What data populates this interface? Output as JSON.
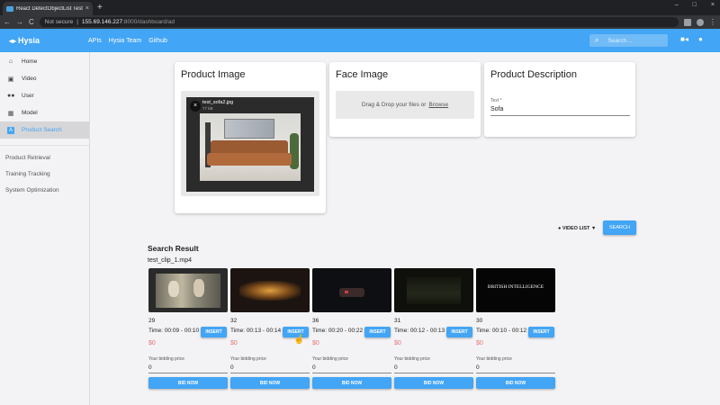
{
  "browser": {
    "tab_title": "React DetectObjectList Test",
    "tab_close": "×",
    "new_tab": "+",
    "security": "Not secure",
    "url_host": "155.69.146.227",
    "url_path": ":8000/dashboard/ad",
    "nav": {
      "back": "←",
      "forward": "→",
      "reload": "C"
    },
    "window": {
      "minimize": "–",
      "maximize": "□",
      "close": "×"
    }
  },
  "header": {
    "logo": "Hysia",
    "links": [
      "APIs",
      "Hysia Team",
      "Github"
    ],
    "search_placeholder": "Search…",
    "search_icon": "search-icon",
    "camera_icon": "videocam-icon",
    "account_icon": "account-icon",
    "colors": {
      "primary": "#42a5f5",
      "price": "#e57373"
    }
  },
  "sidebar": {
    "items": [
      {
        "label": "Home",
        "icon": "home-icon"
      },
      {
        "label": "Video",
        "icon": "video-library-icon"
      },
      {
        "label": "User",
        "icon": "people-icon"
      },
      {
        "label": "Model",
        "icon": "grid-icon"
      },
      {
        "label": "Product Search",
        "icon": "product-search-icon"
      }
    ],
    "links": [
      "Product Retrieval",
      "Training Tracking",
      "System Optimization"
    ]
  },
  "product_image": {
    "title": "Product Image",
    "file_name": "test_sofa2.jpg",
    "file_size": "77 kB",
    "close": "×"
  },
  "face_image": {
    "title": "Face Image",
    "drop_text": "Drag & Drop your files or",
    "browse": "Browse"
  },
  "product_description": {
    "title": "Product Description",
    "field_label": "Text *",
    "field_value": "Sofa"
  },
  "controls": {
    "video_list": "● VIDEO LIST ▼",
    "search_button": "SEARCH"
  },
  "results": {
    "title": "Search Result",
    "clip": "test_clip_1.mp4",
    "insert_label": "INSERT",
    "bid_label": "Your bidding price",
    "bid_button": "BID NOW",
    "items": [
      {
        "count": "29",
        "time": "Time: 00:09 - 00:10",
        "price": "$0",
        "bid": "0",
        "thumb_text": ""
      },
      {
        "count": "32",
        "time": "Time: 00:13 - 00:14",
        "price": "$0",
        "bid": "0",
        "thumb_text": ""
      },
      {
        "count": "36",
        "time": "Time: 00:20 - 00:22",
        "price": "$0",
        "bid": "0",
        "thumb_text": ""
      },
      {
        "count": "31",
        "time": "Time: 00:12 - 00:13",
        "price": "$0",
        "bid": "0",
        "thumb_text": ""
      },
      {
        "count": "30",
        "time": "Time: 00:10 - 00:12",
        "price": "$0",
        "bid": "0",
        "thumb_text": "BRITISH INTELLIGENCE"
      }
    ]
  }
}
